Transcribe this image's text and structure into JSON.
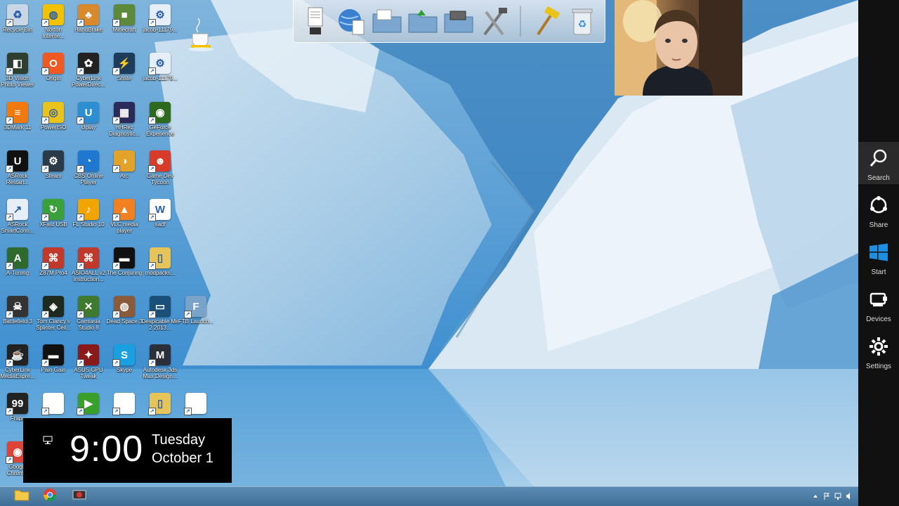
{
  "desktop": {
    "icons": [
      {
        "label": "Recycle Bin",
        "icon": "recycle-bin-icon",
        "color": "#c8d6e6",
        "sym": "♻",
        "col": 0,
        "row": 0
      },
      {
        "label": "Norton Interne...",
        "icon": "globe-icon",
        "color": "#f2c200",
        "sym": "◍",
        "col": 1,
        "row": 0
      },
      {
        "label": "HandBrake",
        "icon": "pineapple-icon",
        "color": "#d8892b",
        "sym": "♣",
        "col": 2,
        "row": 0
      },
      {
        "label": "Minecraft",
        "icon": "grass-block-icon",
        "color": "#5c8a3a",
        "sym": "■",
        "col": 3,
        "row": 0
      },
      {
        "label": "jacob-11179...",
        "icon": "document-icon",
        "color": "#e6eef7",
        "sym": "⚙",
        "col": 4,
        "row": 0
      },
      {
        "label": "3D Vision Photo Viewer",
        "icon": "photo-viewer-icon",
        "color": "#2f3f2f",
        "sym": "◧",
        "col": 0,
        "row": 1
      },
      {
        "label": "Origin",
        "icon": "origin-icon",
        "color": "#f05a22",
        "sym": "O",
        "col": 1,
        "row": 1
      },
      {
        "label": "CyberLink PowerDirec...",
        "icon": "powerdirector-icon",
        "color": "#222",
        "sym": "✿",
        "col": 2,
        "row": 1
      },
      {
        "label": "Smite",
        "icon": "smite-icon",
        "color": "#1d3b5a",
        "sym": "⚡",
        "col": 3,
        "row": 1
      },
      {
        "label": "jacob-11179...",
        "icon": "document-icon",
        "color": "#e6eef7",
        "sym": "⚙",
        "col": 4,
        "row": 1
      },
      {
        "label": "3DMark 11",
        "icon": "3dmark-icon",
        "color": "#f07a10",
        "sym": "≡",
        "col": 0,
        "row": 2
      },
      {
        "label": "PowerISO",
        "icon": "disc-icon",
        "color": "#e9c21a",
        "sym": "◎",
        "col": 1,
        "row": 2
      },
      {
        "label": "Uplay",
        "icon": "uplay-icon",
        "color": "#2d8ed1",
        "sym": "U",
        "col": 2,
        "row": 2
      },
      {
        "label": "HHRez Diagnostic...",
        "icon": "diagnostic-icon",
        "color": "#2b2b5a",
        "sym": "▦",
        "col": 3,
        "row": 2
      },
      {
        "label": "GeForce Experience",
        "icon": "nvidia-icon",
        "color": "#2d6a1e",
        "sym": "◉",
        "col": 4,
        "row": 2
      },
      {
        "label": "ASRock Restart...",
        "icon": "uefi-icon",
        "color": "#111",
        "sym": "U",
        "col": 0,
        "row": 3
      },
      {
        "label": "Steam",
        "icon": "steam-icon",
        "color": "#2b3a48",
        "sym": "⚙",
        "col": 1,
        "row": 3
      },
      {
        "label": "CBS Online Player",
        "icon": "cbs-icon",
        "color": "#1e78d0",
        "sym": "◔",
        "col": 2,
        "row": 3
      },
      {
        "label": "Arc",
        "icon": "arc-icon",
        "color": "#e3a32a",
        "sym": "◑",
        "col": 3,
        "row": 3
      },
      {
        "label": "Game Dev Tycoon",
        "icon": "game-dev-icon",
        "color": "#d93b2b",
        "sym": "☻",
        "col": 4,
        "row": 3
      },
      {
        "label": "ASRock SmartConn...",
        "icon": "smartconnect-icon",
        "color": "#e6eef7",
        "sym": "↗",
        "col": 0,
        "row": 4
      },
      {
        "label": "XFast USB",
        "icon": "xfast-icon",
        "color": "#3aa03a",
        "sym": "↻",
        "col": 1,
        "row": 4
      },
      {
        "label": "FL Studio 10",
        "icon": "fl-studio-icon",
        "color": "#f2a400",
        "sym": "♪",
        "col": 2,
        "row": 4
      },
      {
        "label": "VLC media player",
        "icon": "vlc-icon",
        "color": "#f08020",
        "sym": "▲",
        "col": 3,
        "row": 4
      },
      {
        "label": "sadf",
        "icon": "word-document-icon",
        "color": "#ffffff",
        "sym": "W",
        "col": 4,
        "row": 4
      },
      {
        "label": "A-Tuning",
        "icon": "a-tuning-icon",
        "color": "#2e6a2e",
        "sym": "A",
        "col": 0,
        "row": 5
      },
      {
        "label": "Z87M Pro4",
        "icon": "pdf-icon",
        "color": "#c0392b",
        "sym": "⌘",
        "col": 1,
        "row": 5
      },
      {
        "label": "ASIO4ALL v2 Instruction...",
        "icon": "pdf-icon",
        "color": "#c0392b",
        "sym": "⌘",
        "col": 2,
        "row": 5
      },
      {
        "label": "The Conjuring",
        "icon": "movie-icon",
        "color": "#111",
        "sym": "▬",
        "col": 3,
        "row": 5
      },
      {
        "label": "modpacks...",
        "icon": "folder-icon",
        "color": "#e6c45a",
        "sym": "▯",
        "col": 4,
        "row": 5
      },
      {
        "label": "Battlefield 3",
        "icon": "battlefield-icon",
        "color": "#333",
        "sym": "☠",
        "col": 0,
        "row": 6
      },
      {
        "label": "Tom Clancy's Splinter Cell...",
        "icon": "splinter-cell-icon",
        "color": "#1e2a1e",
        "sym": "◈",
        "col": 1,
        "row": 6
      },
      {
        "label": "Camtasia Studio 8",
        "icon": "camtasia-icon",
        "color": "#3f7a2f",
        "sym": "✕",
        "col": 2,
        "row": 6
      },
      {
        "label": "Dead Space 3",
        "icon": "dead-space-icon",
        "color": "#8a5a3a",
        "sym": "◍",
        "col": 3,
        "row": 6
      },
      {
        "label": "Despicable Me 2 2013...",
        "icon": "video-file-icon",
        "color": "#1a4f7a",
        "sym": "▭",
        "col": 4,
        "row": 6
      },
      {
        "label": "FTB Launch...",
        "icon": "ftb-icon",
        "color": "#7aa3c9",
        "sym": "F",
        "col": 5,
        "row": 6
      },
      {
        "label": "CyberLink MediaEspre...",
        "icon": "mediaespresso-icon",
        "color": "#222",
        "sym": "☕",
        "col": 0,
        "row": 7
      },
      {
        "label": "Pain Gain",
        "icon": "movie-icon",
        "color": "#111",
        "sym": "▬",
        "col": 1,
        "row": 7
      },
      {
        "label": "ASUS GPU Tweak",
        "icon": "gpu-tweak-icon",
        "color": "#8a1a1a",
        "sym": "✦",
        "col": 2,
        "row": 7
      },
      {
        "label": "Skype",
        "icon": "skype-icon",
        "color": "#1aa0e0",
        "sym": "S",
        "col": 3,
        "row": 7
      },
      {
        "label": "Autodesk 3ds Max Design...",
        "icon": "3ds-max-icon",
        "color": "#2a2f3a",
        "sym": "M",
        "col": 4,
        "row": 7
      },
      {
        "label": "Fraps",
        "icon": "fraps-icon",
        "color": "#222",
        "sym": "99",
        "col": 0,
        "row": 8
      },
      {
        "label": "",
        "icon": "blank-file-icon",
        "color": "#ffffff",
        "sym": "",
        "col": 1,
        "row": 8
      },
      {
        "label": "",
        "icon": "media-player-icon",
        "color": "#38a02a",
        "sym": "▶",
        "col": 2,
        "row": 8
      },
      {
        "label": "",
        "icon": "blank-file-icon",
        "color": "#ffffff",
        "sym": "",
        "col": 3,
        "row": 8
      },
      {
        "label": "",
        "icon": "zip-folder-icon",
        "color": "#e6c45a",
        "sym": "▯",
        "col": 4,
        "row": 8
      },
      {
        "label": "",
        "icon": "blank-file-icon",
        "color": "#ffffff",
        "sym": "",
        "col": 5,
        "row": 8
      },
      {
        "label": "Google Chrom...",
        "icon": "chrome-icon",
        "color": "#db4437",
        "sym": "◉",
        "col": 0,
        "row": 9
      }
    ]
  },
  "dock": {
    "items": [
      {
        "name": "dock-document-icon"
      },
      {
        "name": "dock-globe-icon"
      },
      {
        "name": "dock-folder-icon"
      },
      {
        "name": "dock-folder-icon"
      },
      {
        "name": "dock-drive-icon"
      },
      {
        "name": "dock-tools-icon"
      }
    ],
    "right": [
      {
        "name": "dock-hammer-icon"
      },
      {
        "name": "dock-recycle-bin-icon"
      }
    ]
  },
  "charms": {
    "items": [
      {
        "label": "Search",
        "icon": "search-icon",
        "active": true
      },
      {
        "label": "Share",
        "icon": "share-icon",
        "active": false
      },
      {
        "label": "Start",
        "icon": "windows-logo-icon",
        "active": false
      },
      {
        "label": "Devices",
        "icon": "devices-icon",
        "active": false
      },
      {
        "label": "Settings",
        "icon": "gear-icon",
        "active": false
      }
    ]
  },
  "clock": {
    "time": "9:00",
    "day": "Tuesday",
    "date": "October 1"
  },
  "taskbar": {
    "pinned": [
      {
        "icon": "file-explorer-icon"
      },
      {
        "icon": "chrome-icon"
      },
      {
        "icon": "camtasia-recorder-icon"
      }
    ]
  },
  "colors": {
    "charms_bg": "#111111",
    "clock_bg": "#000000",
    "taskbar": "#4a7aa4"
  }
}
